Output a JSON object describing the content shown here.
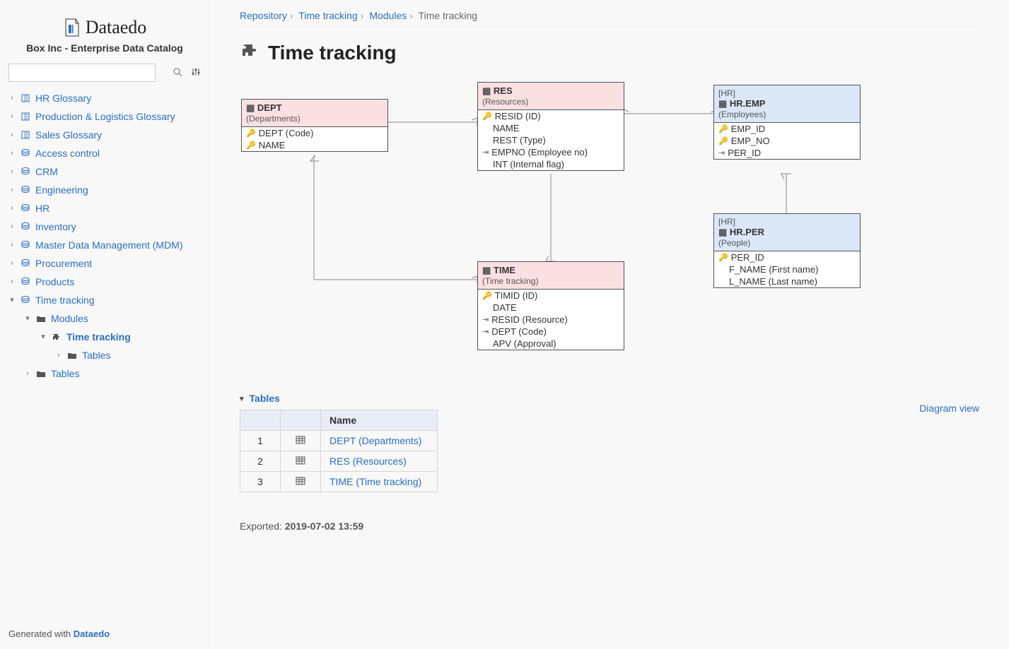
{
  "sidebar": {
    "brand": "Dataedo",
    "subtitle": "Box Inc - Enterprise Data Catalog",
    "search_placeholder": "",
    "nodes": [
      {
        "label": "HR Glossary",
        "icon": "book"
      },
      {
        "label": "Production & Logistics Glossary",
        "icon": "book"
      },
      {
        "label": "Sales Glossary",
        "icon": "book"
      },
      {
        "label": "Access control",
        "icon": "db"
      },
      {
        "label": "CRM",
        "icon": "db"
      },
      {
        "label": "Engineering",
        "icon": "db"
      },
      {
        "label": "HR",
        "icon": "db"
      },
      {
        "label": "Inventory",
        "icon": "db"
      },
      {
        "label": "Master Data Management (MDM)",
        "icon": "db"
      },
      {
        "label": "Procurement",
        "icon": "db"
      },
      {
        "label": "Products",
        "icon": "db"
      },
      {
        "label": "Time tracking",
        "icon": "db"
      }
    ],
    "time_tracking_children": {
      "modules": "Modules",
      "module_item": "Time tracking",
      "module_sub": "Tables",
      "tables": "Tables"
    },
    "footer_prefix": "Generated with ",
    "footer_brand": "Dataedo"
  },
  "breadcrumb": {
    "a": "Repository",
    "b": "Time tracking",
    "c": "Modules",
    "current": "Time tracking"
  },
  "page_title": "Time tracking",
  "diagram_view_link": "Diagram view",
  "entities": {
    "dept": {
      "title": "DEPT",
      "sub": "(Departments)",
      "cols": [
        {
          "k": "key",
          "t": "DEPT (Code)"
        },
        {
          "k": "key",
          "t": "NAME"
        }
      ]
    },
    "res": {
      "title": "RES",
      "sub": "(Resources)",
      "cols": [
        {
          "k": "key",
          "t": "RESID (ID)"
        },
        {
          "k": "",
          "t": "NAME"
        },
        {
          "k": "",
          "t": "REST (Type)"
        },
        {
          "k": "fk",
          "t": "EMPNO (Employee no)"
        },
        {
          "k": "",
          "t": "INT (Internal flag)"
        }
      ]
    },
    "time": {
      "title": "TIME",
      "sub": "(Time tracking)",
      "cols": [
        {
          "k": "key",
          "t": "TIMID (ID)"
        },
        {
          "k": "",
          "t": "DATE"
        },
        {
          "k": "fk",
          "t": "RESID (Resource)"
        },
        {
          "k": "fk",
          "t": "DEPT (Code)"
        },
        {
          "k": "",
          "t": "APV (Approval)"
        }
      ]
    },
    "emp": {
      "schema": "[HR]",
      "title": "HR.EMP",
      "sub": "(Employees)",
      "cols": [
        {
          "k": "key",
          "t": "EMP_ID"
        },
        {
          "k": "key",
          "t": "EMP_NO"
        },
        {
          "k": "fk",
          "t": "PER_ID"
        }
      ]
    },
    "per": {
      "schema": "[HR]",
      "title": "HR.PER",
      "sub": "(People)",
      "cols": [
        {
          "k": "key",
          "t": "PER_ID"
        },
        {
          "k": "",
          "t": "F_NAME (First name)"
        },
        {
          "k": "",
          "t": "L_NAME (Last name)"
        }
      ]
    }
  },
  "tables_section": {
    "heading": "Tables",
    "col_name": "Name",
    "rows": [
      {
        "n": "1",
        "name": "DEPT (Departments)"
      },
      {
        "n": "2",
        "name": "RES (Resources)"
      },
      {
        "n": "3",
        "name": "TIME (Time tracking)"
      }
    ]
  },
  "exported": {
    "label": "Exported: ",
    "value": "2019-07-02 13:59"
  }
}
